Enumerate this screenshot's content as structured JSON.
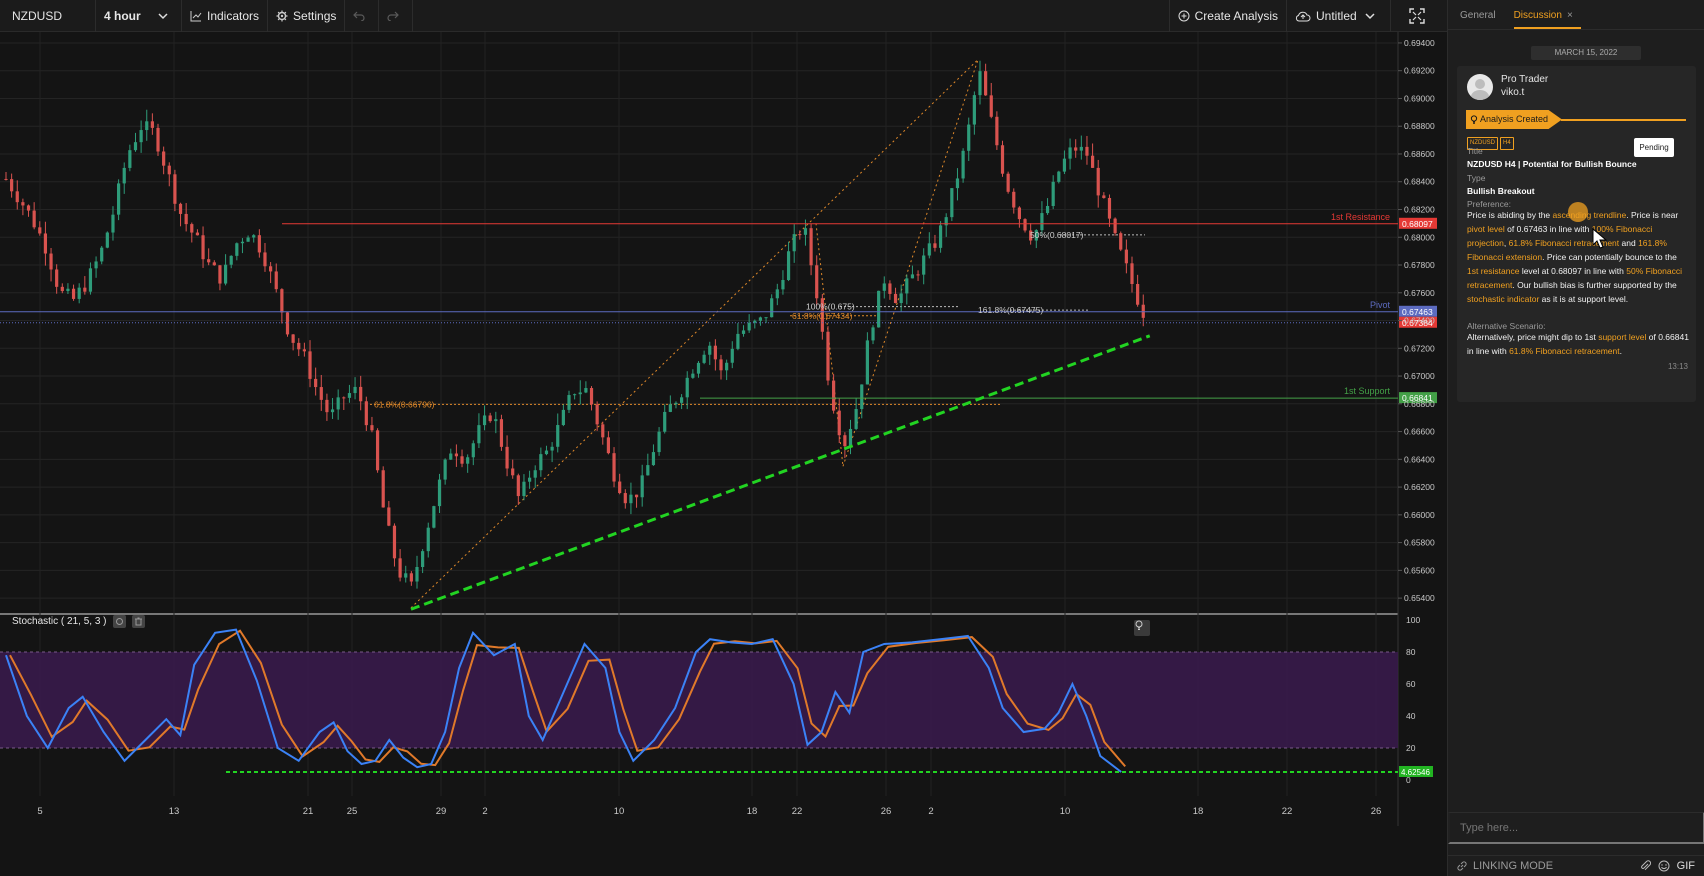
{
  "toolbar": {
    "symbol": "NZDUSD",
    "interval": "4 hour",
    "indicators_label": "Indicators",
    "settings_label": "Settings",
    "create_analysis_label": "Create Analysis",
    "layout_label": "Untitled"
  },
  "chart_data": {
    "type": "candlestick",
    "symbol": "NZDUSD",
    "timeframe": "4 hour",
    "y_axis": {
      "ticks": [
        "0.69400",
        "0.69200",
        "0.69000",
        "0.68800",
        "0.68600",
        "0.68400",
        "0.68200",
        "0.68000",
        "0.67800",
        "0.67600",
        "0.67400",
        "0.67200",
        "0.67000",
        "0.66800",
        "0.66600",
        "0.66400",
        "0.66200",
        "0.66000",
        "0.65800",
        "0.65600",
        "0.65400"
      ],
      "min": 0.653,
      "max": 0.6945
    },
    "x_axis": {
      "ticks": [
        "5",
        "13",
        "21",
        "25",
        "29",
        "2",
        "10",
        "18",
        "22",
        "26",
        "2",
        "10",
        "18",
        "22",
        "26"
      ]
    },
    "price_path": [
      [
        0,
        0.6842
      ],
      [
        2,
        0.6828
      ],
      [
        4,
        0.6812
      ],
      [
        6,
        0.6792
      ],
      [
        8,
        0.676
      ],
      [
        10,
        0.6755
      ],
      [
        12,
        0.6768
      ],
      [
        14,
        0.6788
      ],
      [
        16,
        0.682
      ],
      [
        18,
        0.686
      ],
      [
        20,
        0.688
      ],
      [
        22,
        0.6875
      ],
      [
        24,
        0.6845
      ],
      [
        26,
        0.6815
      ],
      [
        28,
        0.68
      ],
      [
        30,
        0.678
      ],
      [
        32,
        0.677
      ],
      [
        34,
        0.6795
      ],
      [
        36,
        0.6805
      ],
      [
        38,
        0.679
      ],
      [
        40,
        0.676
      ],
      [
        42,
        0.673
      ],
      [
        44,
        0.6715
      ],
      [
        46,
        0.669
      ],
      [
        48,
        0.667
      ],
      [
        50,
        0.6685
      ],
      [
        52,
        0.669
      ],
      [
        54,
        0.666
      ],
      [
        56,
        0.66
      ],
      [
        58,
        0.656
      ],
      [
        60,
        0.6548
      ],
      [
        62,
        0.6585
      ],
      [
        64,
        0.662
      ],
      [
        66,
        0.665
      ],
      [
        68,
        0.664
      ],
      [
        70,
        0.666
      ],
      [
        72,
        0.6675
      ],
      [
        74,
        0.664
      ],
      [
        76,
        0.661
      ],
      [
        78,
        0.6635
      ],
      [
        80,
        0.6645
      ],
      [
        82,
        0.6665
      ],
      [
        84,
        0.669
      ],
      [
        86,
        0.669
      ],
      [
        88,
        0.666
      ],
      [
        90,
        0.663
      ],
      [
        92,
        0.661
      ],
      [
        94,
        0.662
      ],
      [
        96,
        0.665
      ],
      [
        98,
        0.6675
      ],
      [
        100,
        0.669
      ],
      [
        102,
        0.671
      ],
      [
        104,
        0.6725
      ],
      [
        106,
        0.67
      ],
      [
        108,
        0.673
      ],
      [
        110,
        0.6735
      ],
      [
        112,
        0.674
      ],
      [
        114,
        0.676
      ],
      [
        116,
        0.679
      ],
      [
        118,
        0.681
      ],
      [
        120,
        0.676
      ],
      [
        122,
        0.669
      ],
      [
        124,
        0.665
      ],
      [
        126,
        0.668
      ],
      [
        128,
        0.6735
      ],
      [
        130,
        0.677
      ],
      [
        132,
        0.6755
      ],
      [
        134,
        0.677
      ],
      [
        136,
        0.6785
      ],
      [
        138,
        0.68
      ],
      [
        140,
        0.683
      ],
      [
        142,
        0.6865
      ],
      [
        144,
        0.692
      ],
      [
        146,
        0.688
      ],
      [
        148,
        0.684
      ],
      [
        150,
        0.6815
      ],
      [
        152,
        0.68
      ],
      [
        154,
        0.682
      ],
      [
        156,
        0.685
      ],
      [
        158,
        0.6865
      ],
      [
        160,
        0.686
      ],
      [
        162,
        0.683
      ],
      [
        164,
        0.68
      ],
      [
        166,
        0.6775
      ],
      [
        168,
        0.675
      ],
      [
        169,
        0.6739
      ]
    ],
    "levels": [
      {
        "name": "1st Resistance",
        "price": 0.68097,
        "label": "0.68097",
        "color": "#e53935"
      },
      {
        "name": "Pivot",
        "price": 0.67463,
        "label": "0.67463",
        "color": "#5c6bc0"
      },
      {
        "name": "1st Support",
        "price": 0.66841,
        "label": "0.66841",
        "color": "#43a047"
      }
    ],
    "current_price": {
      "price": 0.67384,
      "label": "0.67384"
    },
    "annotations": [
      {
        "text": "1st Resistance"
      },
      {
        "text": "Pivot"
      },
      {
        "text": "1st Support"
      },
      {
        "text": "50%(0.68017)",
        "price": 0.68017
      },
      {
        "text": "100%(0.675)",
        "price": 0.675
      },
      {
        "text": "161.8%(0.67475)",
        "price": 0.67475
      },
      {
        "text": "61.8%(0.67434)",
        "price": 0.67434
      },
      {
        "text": "61.8%(0.66796)",
        "price": 0.66796
      }
    ],
    "ascending_trendline": {
      "from": [
        60,
        0.6532
      ],
      "to": [
        169,
        0.6729
      ]
    },
    "stochastic": {
      "title": "Stochastic ( 21, 5, 3 )",
      "y_ticks": [
        "100",
        "80",
        "60",
        "40",
        "20",
        "0"
      ],
      "overbought": 80,
      "oversold": 20,
      "current_label": "4.62546",
      "k_path": [
        [
          0,
          78
        ],
        [
          3,
          40
        ],
        [
          6,
          20
        ],
        [
          9,
          45
        ],
        [
          11,
          52
        ],
        [
          14,
          30
        ],
        [
          17,
          12
        ],
        [
          20,
          25
        ],
        [
          23,
          38
        ],
        [
          25,
          28
        ],
        [
          27,
          72
        ],
        [
          30,
          92
        ],
        [
          33,
          94
        ],
        [
          36,
          62
        ],
        [
          39,
          20
        ],
        [
          42,
          12
        ],
        [
          45,
          30
        ],
        [
          47,
          36
        ],
        [
          49,
          18
        ],
        [
          51,
          10
        ],
        [
          53,
          12
        ],
        [
          55,
          25
        ],
        [
          57,
          14
        ],
        [
          59,
          8
        ],
        [
          61,
          10
        ],
        [
          63,
          30
        ],
        [
          65,
          70
        ],
        [
          67,
          92
        ],
        [
          70,
          78
        ],
        [
          73,
          85
        ],
        [
          75,
          40
        ],
        [
          77,
          25
        ],
        [
          80,
          55
        ],
        [
          83,
          85
        ],
        [
          86,
          70
        ],
        [
          88,
          30
        ],
        [
          90,
          12
        ],
        [
          93,
          25
        ],
        [
          96,
          45
        ],
        [
          99,
          80
        ],
        [
          101,
          88
        ],
        [
          104,
          86
        ],
        [
          107,
          85
        ],
        [
          110,
          88
        ],
        [
          113,
          60
        ],
        [
          115,
          22
        ],
        [
          117,
          30
        ],
        [
          119,
          55
        ],
        [
          121,
          42
        ],
        [
          123,
          80
        ],
        [
          126,
          85
        ],
        [
          130,
          86
        ],
        [
          134,
          88
        ],
        [
          138,
          90
        ],
        [
          141,
          70
        ],
        [
          143,
          45
        ],
        [
          146,
          30
        ],
        [
          149,
          32
        ],
        [
          151,
          42
        ],
        [
          153,
          60
        ],
        [
          155,
          40
        ],
        [
          157,
          15
        ],
        [
          160,
          5
        ]
      ]
    }
  },
  "panel": {
    "tab_general": "General",
    "tab_discussion": "Discussion",
    "tab_close": "×",
    "date": "MARCH 15, 2022",
    "user_role": "Pro Trader",
    "user_name": "viko.t",
    "status": "Analysis Created",
    "pending": "Pending",
    "tags": [
      "NZDUSD",
      "H4"
    ],
    "title_label": "Title",
    "title_value": "NZDUSD H4 | Potential for Bullish Bounce",
    "type_label": "Type",
    "type_value": "Bullish Breakout",
    "preference_label": "Preference:",
    "pref": {
      "t1": "Price is abiding by the ",
      "h1": "ascending trendline",
      "t2": ". Price is near ",
      "h2": "pivot level",
      "t3": " of 0.67463 in line with ",
      "h3": "100% Fibonacci projection",
      "t4": ", ",
      "h4": "61.8% Fibonacci retracement",
      "t5": " and ",
      "h5": "161.8% Fibonacci extension",
      "t6": ". Price can potentially bounce to the ",
      "h6": "1st resistance",
      "t7": " level at 0.68097 in line with ",
      "h7": "50% Fibonacci retracement",
      "t8": ". Our bullish bias is further supported by the ",
      "h8": "stochastic indicator",
      "t9": " as it is at support level."
    },
    "alt_label": "Alternative Scenario:",
    "alt": {
      "t1": "Alternatively, price might dip to 1st ",
      "h1": "support level",
      "t2": " of 0.66841 in line with ",
      "h2": "61.8% Fibonacci retracement",
      "t3": "."
    },
    "time": "13:13",
    "reply_placeholder": "Type here...",
    "linking_mode": "LINKING MODE",
    "gif_label": "GIF"
  }
}
